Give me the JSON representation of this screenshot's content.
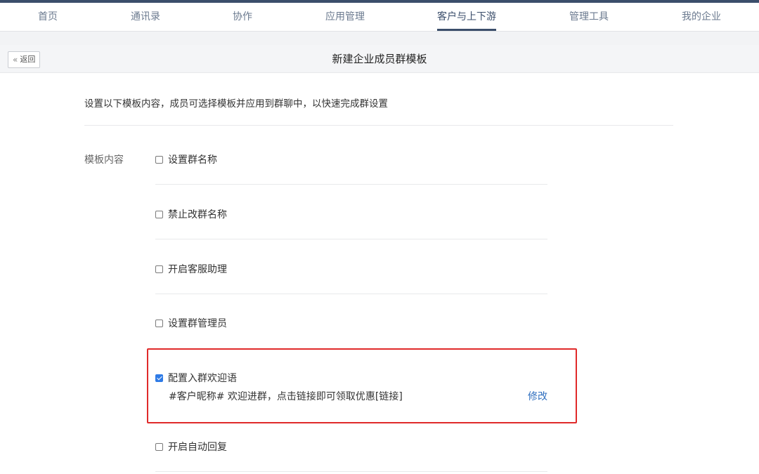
{
  "nav": {
    "items": [
      {
        "label": "首页",
        "active": false
      },
      {
        "label": "通讯录",
        "active": false
      },
      {
        "label": "协作",
        "active": false
      },
      {
        "label": "应用管理",
        "active": false
      },
      {
        "label": "客户与上下游",
        "active": true
      },
      {
        "label": "管理工具",
        "active": false
      },
      {
        "label": "我的企业",
        "active": false
      }
    ]
  },
  "header": {
    "back_label": "返回",
    "back_icon": "«",
    "title": "新建企业成员群模板"
  },
  "intro": "设置以下模板内容，成员可选择模板并应用到群聊中，以快速完成群设置",
  "section_label": "模板内容",
  "options": [
    {
      "label": "设置群名称",
      "checked": false
    },
    {
      "label": "禁止改群名称",
      "checked": false
    },
    {
      "label": "开启客服助理",
      "checked": false
    },
    {
      "label": "设置群管理员",
      "checked": false
    },
    {
      "label": "配置入群欢迎语",
      "checked": true
    },
    {
      "label": "开启自动回复",
      "checked": false
    }
  ],
  "welcome": {
    "text": "#客户昵称# 欢迎进群，点击链接即可领取优惠[链接]",
    "edit_label": "修改"
  },
  "colors": {
    "nav_active": "#3b4e6b",
    "checkbox_checked": "#2f7be6",
    "highlight": "#e02a2a",
    "link": "#2f6fbf"
  }
}
